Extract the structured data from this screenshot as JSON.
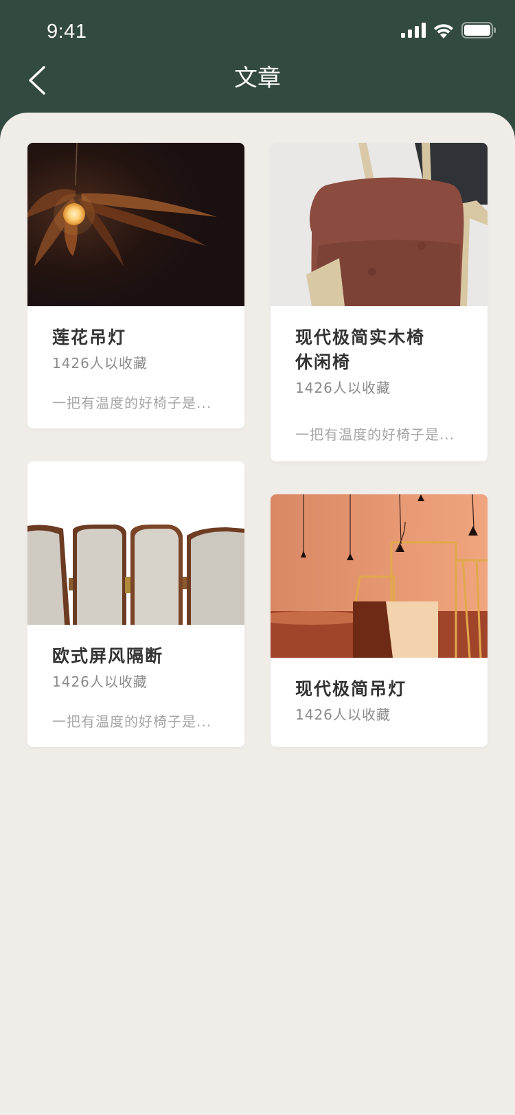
{
  "status_bar": {
    "time": "9:41"
  },
  "nav": {
    "title": "文章"
  },
  "cards": [
    {
      "title": "莲花吊灯",
      "favorites": "1426人以收藏",
      "excerpt": "一把有温度的好椅子是..."
    },
    {
      "title": "现代极简实木椅休闲椅",
      "favorites": "1426人以收藏",
      "excerpt": "一把有温度的好椅子是..."
    },
    {
      "title": "欧式屏风隔断",
      "favorites": "1426人以收藏",
      "excerpt": "一把有温度的好椅子是..."
    },
    {
      "title": "现代极简吊灯",
      "favorites": "1426人以收藏"
    }
  ],
  "colors": {
    "header": "#334a40",
    "page_bg": "#f0ece8",
    "card_bg": "#ffffff"
  }
}
